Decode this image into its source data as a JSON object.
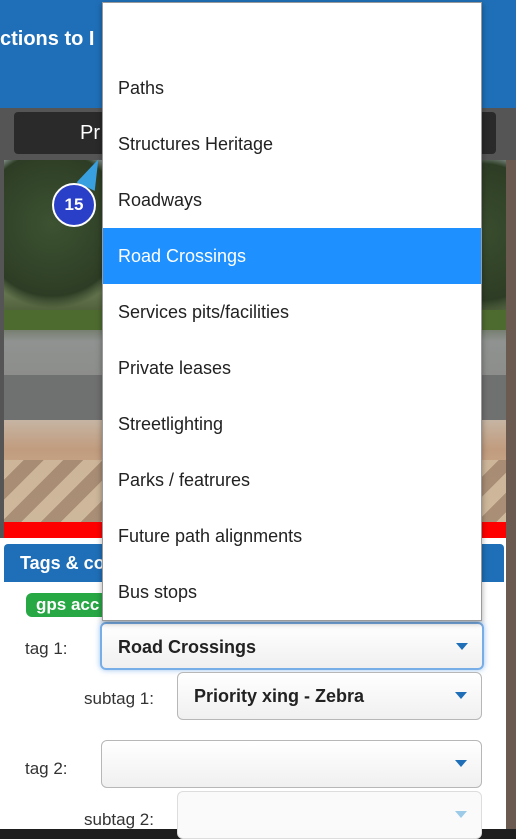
{
  "header": {
    "title": "ctions to I"
  },
  "toolbar": {
    "pill_text": "Pr"
  },
  "map": {
    "marker_label": "15"
  },
  "tags_panel": {
    "heading": "Tags & co",
    "gps_badge": "gps acc",
    "tag1_label": "tag 1:",
    "tag1_value": "Road Crossings",
    "subtag1_label": "subtag 1:",
    "subtag1_value": "Priority xing - Zebra",
    "tag2_label": "tag 2:",
    "tag2_value": "",
    "subtag2_label": "subtag 2:",
    "subtag2_value": ""
  },
  "dropdown": {
    "options": [
      "",
      "Paths",
      "Structures Heritage",
      "Roadways",
      "Road Crossings",
      "Services pits/facilities",
      "Private leases",
      "Streetlighting",
      "Parks / featrures",
      "Future path alignments",
      "Bus stops"
    ],
    "selected_index": 4
  },
  "colors": {
    "accent": "#1f6fb8",
    "selected_option": "#1e90ff",
    "gps_badge": "#28a745",
    "alert_bar": "#ff0000"
  }
}
